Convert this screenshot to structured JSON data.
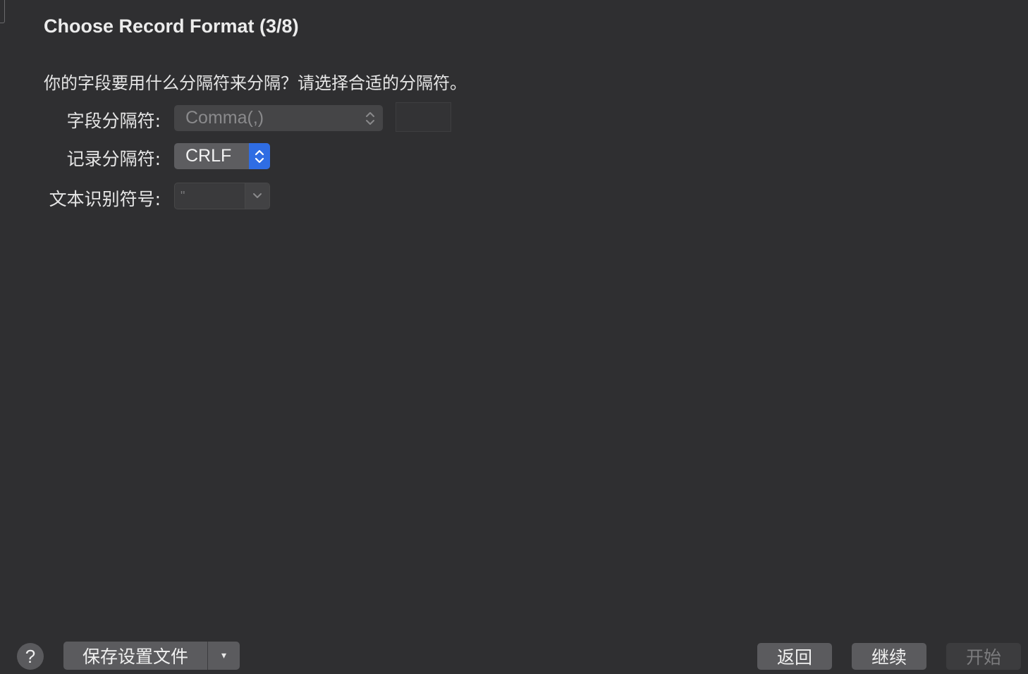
{
  "title": "Choose Record Format (3/8)",
  "question": "你的字段要用什么分隔符来分隔？请选择合适的分隔符。",
  "fields": {
    "field_delimiter": {
      "label": "字段分隔符:",
      "value": "Comma(,)"
    },
    "record_delimiter": {
      "label": "记录分隔符:",
      "value": "CRLF"
    },
    "text_qualifier": {
      "label": "文本识别符号:",
      "value": "\""
    }
  },
  "footer": {
    "help": "?",
    "save_settings": "保存设置文件",
    "save_menu_arrow": "▾",
    "back": "返回",
    "continue": "继续",
    "start": "开始"
  },
  "colors": {
    "background": "#2f2f31",
    "accent": "#2f6de3"
  }
}
